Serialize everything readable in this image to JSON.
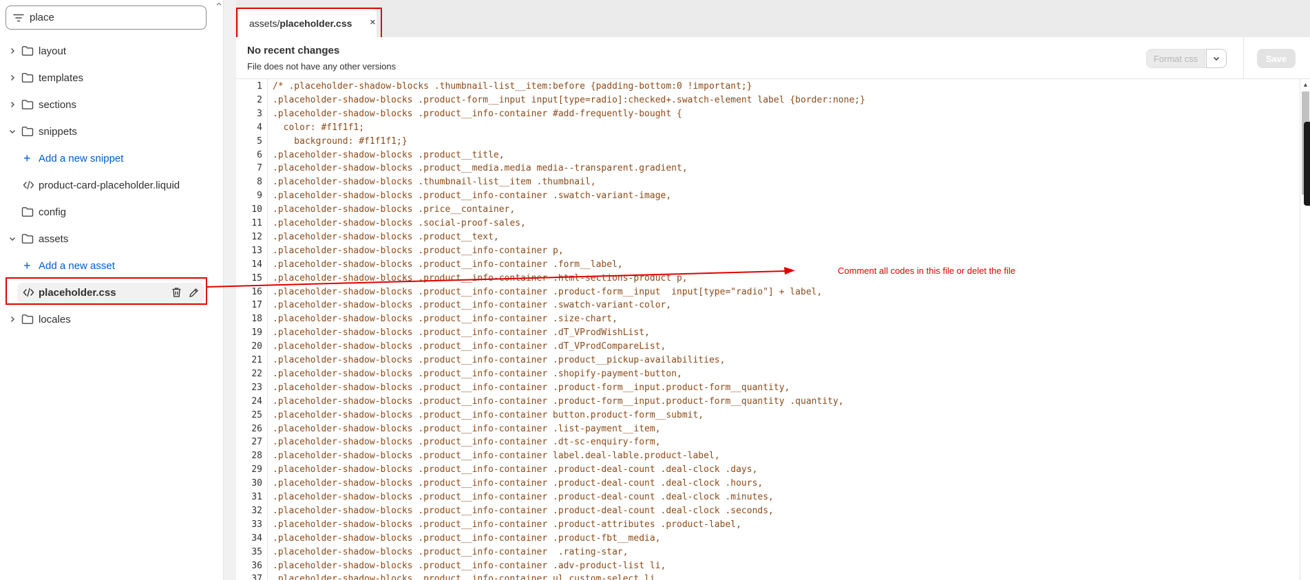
{
  "sidebar": {
    "search_value": "place",
    "items": [
      {
        "label": "layout",
        "kind": "folder",
        "expanded": false
      },
      {
        "label": "templates",
        "kind": "folder",
        "expanded": false
      },
      {
        "label": "sections",
        "kind": "folder",
        "expanded": false
      },
      {
        "label": "snippets",
        "kind": "folder",
        "expanded": true
      },
      {
        "label": "Add a new snippet",
        "kind": "add"
      },
      {
        "label": "product-card-placeholder.liquid",
        "kind": "file"
      },
      {
        "label": "config",
        "kind": "folder-plain"
      },
      {
        "label": "assets",
        "kind": "folder",
        "expanded": true
      },
      {
        "label": "Add a new asset",
        "kind": "add"
      },
      {
        "label": "placeholder.css",
        "kind": "file",
        "selected": true
      },
      {
        "label": "locales",
        "kind": "folder",
        "expanded": false
      }
    ]
  },
  "tab": {
    "prefix": "assets/",
    "filename": "placeholder.css",
    "close": "×"
  },
  "header": {
    "title": "No recent changes",
    "subtitle": "File does not have any other versions",
    "format_label": "Format css",
    "save_label": "Save"
  },
  "annotation": "Comment all codes in this file or delet the file",
  "colors": {
    "accent_link": "#005bd3",
    "annotation_red": "#e00000",
    "code_text": "#8a4a1a"
  },
  "code_lines": [
    "/* .placeholder-shadow-blocks .thumbnail-list__item:before {padding-bottom:0 !important;}",
    ".placeholder-shadow-blocks .product-form__input input[type=radio]:checked+.swatch-element label {border:none;}",
    ".placeholder-shadow-blocks .product__info-container #add-frequently-bought {",
    "  color: #f1f1f1;",
    "    background: #f1f1f1;}",
    ".placeholder-shadow-blocks .product__title,",
    ".placeholder-shadow-blocks .product__media.media media--transparent.gradient,",
    ".placeholder-shadow-blocks .thumbnail-list__item .thumbnail,",
    ".placeholder-shadow-blocks .product__info-container .swatch-variant-image,",
    ".placeholder-shadow-blocks .price__container,",
    ".placeholder-shadow-blocks .social-proof-sales,",
    ".placeholder-shadow-blocks .product__text,",
    ".placeholder-shadow-blocks .product__info-container p,",
    ".placeholder-shadow-blocks .product__info-container .form__label,",
    ".placeholder-shadow-blocks .product__info-container .html-sections-product p,",
    ".placeholder-shadow-blocks .product__info-container .product-form__input  input[type=\"radio\"] + label,",
    ".placeholder-shadow-blocks .product__info-container .swatch-variant-color,",
    ".placeholder-shadow-blocks .product__info-container .size-chart,",
    ".placeholder-shadow-blocks .product__info-container .dT_VProdWishList,",
    ".placeholder-shadow-blocks .product__info-container .dT_VProdCompareList,",
    ".placeholder-shadow-blocks .product__info-container .product__pickup-availabilities,",
    ".placeholder-shadow-blocks .product__info-container .shopify-payment-button,",
    ".placeholder-shadow-blocks .product__info-container .product-form__input.product-form__quantity,",
    ".placeholder-shadow-blocks .product__info-container .product-form__input.product-form__quantity .quantity,",
    ".placeholder-shadow-blocks .product__info-container button.product-form__submit,",
    ".placeholder-shadow-blocks .product__info-container .list-payment__item,",
    ".placeholder-shadow-blocks .product__info-container .dt-sc-enquiry-form,",
    ".placeholder-shadow-blocks .product__info-container label.deal-lable.product-label,",
    ".placeholder-shadow-blocks .product__info-container .product-deal-count .deal-clock .days,",
    ".placeholder-shadow-blocks .product__info-container .product-deal-count .deal-clock .hours,",
    ".placeholder-shadow-blocks .product__info-container .product-deal-count .deal-clock .minutes,",
    ".placeholder-shadow-blocks .product__info-container .product-deal-count .deal-clock .seconds,",
    ".placeholder-shadow-blocks .product__info-container .product-attributes .product-label,",
    ".placeholder-shadow-blocks .product__info-container .product-fbt__media,",
    ".placeholder-shadow-blocks .product__info-container  .rating-star,",
    ".placeholder-shadow-blocks .product__info-container .adv-product-list li,",
    ".placeholder-shadow-blocks .product__info-container ul.custom-select li,"
  ]
}
